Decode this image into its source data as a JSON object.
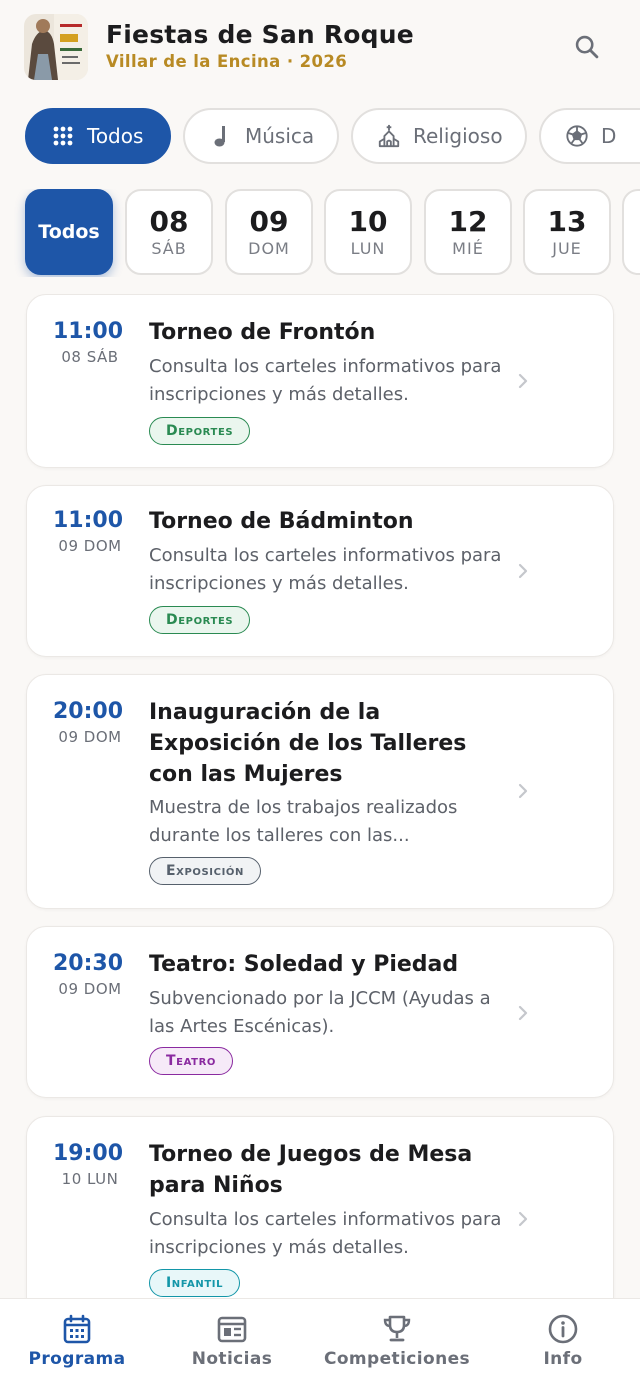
{
  "header": {
    "title": "Fiestas de San Roque",
    "subtitle": "Villar de la Encina · 2026",
    "logo_icon": "festival-poster-logo",
    "search_icon": "search-icon"
  },
  "categories": [
    {
      "label": "Todos",
      "icon": "grid-icon",
      "active": true
    },
    {
      "label": "Música",
      "icon": "music-note-icon",
      "active": false
    },
    {
      "label": "Religioso",
      "icon": "church-icon",
      "active": false
    },
    {
      "label": "D",
      "icon": "soccer-ball-icon",
      "active": false
    }
  ],
  "dates": [
    {
      "label": "Todos",
      "active": true
    },
    {
      "num": "08",
      "day": "SÁB"
    },
    {
      "num": "09",
      "day": "DOM"
    },
    {
      "num": "10",
      "day": "LUN"
    },
    {
      "num": "12",
      "day": "MIÉ"
    },
    {
      "num": "13",
      "day": "JUE"
    }
  ],
  "events": [
    {
      "time": "11:00",
      "day": "08 SÁB",
      "name": "Torneo de Frontón",
      "desc": "Consulta los carteles informativos para inscripciones y más detalles.",
      "tag": "Deportes",
      "tag_color": "#2a8a52"
    },
    {
      "time": "11:00",
      "day": "09 DOM",
      "name": "Torneo de Bádminton",
      "desc": "Consulta los carteles informativos para inscripciones y más detalles.",
      "tag": "Deportes",
      "tag_color": "#2a8a52"
    },
    {
      "time": "20:00",
      "day": "09 DOM",
      "name": "Inauguración de la Exposición de los Talleres con las Mujeres",
      "desc": "Muestra de los trabajos realizados durante los talleres con las...",
      "tag": "Exposición",
      "tag_color": "#56606c"
    },
    {
      "time": "20:30",
      "day": "09 DOM",
      "name": "Teatro: Soledad y Piedad",
      "desc": "Subvencionado por la JCCM (Ayudas a las Artes Escénicas).",
      "tag": "Teatro",
      "tag_color": "#8a2aa0"
    },
    {
      "time": "19:00",
      "day": "10 LUN",
      "name": "Torneo de Juegos de Mesa para Niños",
      "desc": "Consulta los carteles informativos para inscripciones y más detalles.",
      "tag": "Infantil",
      "tag_color": "#1396a8"
    }
  ],
  "nav": [
    {
      "label": "Programa",
      "icon": "calendar-icon",
      "active": true
    },
    {
      "label": "Noticias",
      "icon": "newspaper-icon",
      "active": false
    },
    {
      "label": "Competiciones",
      "icon": "trophy-icon",
      "active": false
    },
    {
      "label": "Info",
      "icon": "info-icon",
      "active": false
    }
  ],
  "colors": {
    "primary": "#1e56a8",
    "accent_gold": "#b88a24",
    "background": "#faf8f6"
  }
}
